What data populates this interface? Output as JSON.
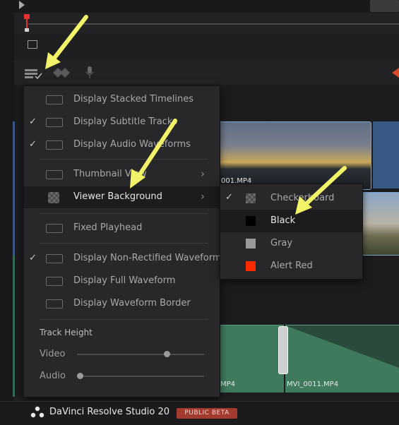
{
  "menu": {
    "items": [
      {
        "label": "Display Stacked Timelines",
        "checked": false,
        "icon": "stacked-timelines-icon"
      },
      {
        "label": "Display Subtitle Tracks",
        "checked": true,
        "icon": "subtitle-tracks-icon"
      },
      {
        "label": "Display Audio Waveforms",
        "checked": true,
        "icon": "audio-waveforms-icon"
      },
      {
        "label": "Thumbnail View",
        "submenu": true,
        "icon": "thumbnail-view-icon"
      },
      {
        "label": "Viewer Background",
        "submenu": true,
        "highlighted": true,
        "icon": "checker-icon"
      },
      {
        "label": "Fixed Playhead",
        "checked": false,
        "icon": "fixed-playhead-icon"
      },
      {
        "label": "Display Non-Rectified Waveform",
        "checked": true,
        "icon": "waveform-icon"
      },
      {
        "label": "Display Full Waveform",
        "checked": false,
        "icon": "full-waveform-icon"
      },
      {
        "label": "Display Waveform Border",
        "checked": false,
        "icon": "waveform-border-icon"
      }
    ],
    "track_height": {
      "title": "Track Height",
      "video_label": "Video",
      "audio_label": "Audio",
      "video_level": 0.72,
      "audio_level": 0.0
    }
  },
  "submenu": {
    "items": [
      {
        "label": "Checkerboard",
        "checked": true,
        "swatch": "checker"
      },
      {
        "label": "Black",
        "checked": false,
        "swatch": "#000000",
        "highlighted": true
      },
      {
        "label": "Gray",
        "checked": false,
        "swatch": "#9a9a9a"
      },
      {
        "label": "Alert Red",
        "checked": false,
        "swatch": "#ff2a00"
      }
    ]
  },
  "clips": {
    "video_top_label": "001.MP4",
    "audio_left_label": "MP4",
    "audio_right_label": "MVI_0011.MP4"
  },
  "footer": {
    "brand": "DaVinci Resolve Studio 20",
    "badge": "PUBLIC BETA"
  },
  "colors": {
    "accent_red": "#a33a2e",
    "annotation_arrow": "#f3f36a"
  }
}
